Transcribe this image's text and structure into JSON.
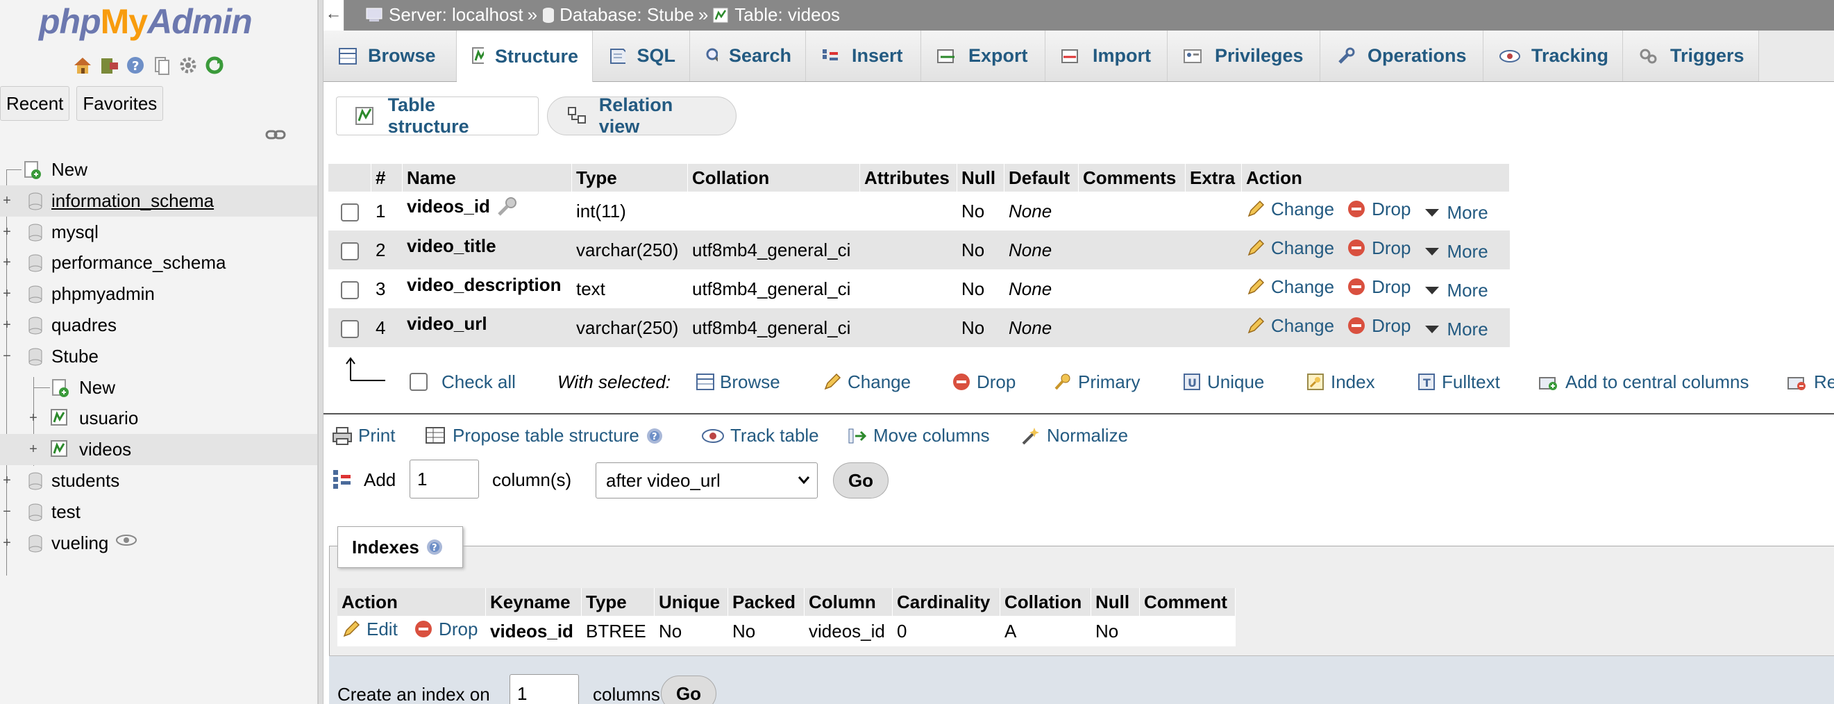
{
  "logo": {
    "php": "php",
    "my": "My",
    "admin": "Admin"
  },
  "nav": {
    "tabs": [
      "Recent",
      "Favorites"
    ],
    "tree": [
      {
        "label": "New",
        "type": "new",
        "level": 0
      },
      {
        "label": "information_schema",
        "type": "db",
        "level": 0,
        "hover": true
      },
      {
        "label": "mysql",
        "type": "db",
        "level": 0
      },
      {
        "label": "performance_schema",
        "type": "db",
        "level": 0
      },
      {
        "label": "phpmyadmin",
        "type": "db",
        "level": 0
      },
      {
        "label": "quadres",
        "type": "db",
        "level": 0
      },
      {
        "label": "Stube",
        "type": "db",
        "level": 0,
        "expanded": true
      },
      {
        "label": "New",
        "type": "new",
        "level": 1
      },
      {
        "label": "usuario",
        "type": "table",
        "level": 1
      },
      {
        "label": "videos",
        "type": "table",
        "level": 1,
        "selected": true
      },
      {
        "label": "students",
        "type": "db",
        "level": 0
      },
      {
        "label": "test",
        "type": "db",
        "level": 0,
        "expanded": true
      },
      {
        "label": "vueling",
        "type": "db",
        "level": 0,
        "eye": true
      }
    ]
  },
  "breadcrumb": {
    "server": "Server: localhost",
    "database": "Database: Stube",
    "table": "Table: videos",
    "sep": "»"
  },
  "tabs": [
    {
      "label": "Browse",
      "icon": "browse-icon"
    },
    {
      "label": "Structure",
      "icon": "structure-icon",
      "active": true
    },
    {
      "label": "SQL",
      "icon": "sql-icon"
    },
    {
      "label": "Search",
      "icon": "search-icon"
    },
    {
      "label": "Insert",
      "icon": "insert-icon"
    },
    {
      "label": "Export",
      "icon": "export-icon"
    },
    {
      "label": "Import",
      "icon": "import-icon"
    },
    {
      "label": "Privileges",
      "icon": "privileges-icon"
    },
    {
      "label": "Operations",
      "icon": "operations-icon"
    },
    {
      "label": "Tracking",
      "icon": "tracking-icon"
    },
    {
      "label": "Triggers",
      "icon": "triggers-icon"
    }
  ],
  "subtabs": {
    "table_structure": "Table structure",
    "relation_view": "Relation view"
  },
  "structure": {
    "headers": [
      "#",
      "Name",
      "Type",
      "Collation",
      "Attributes",
      "Null",
      "Default",
      "Comments",
      "Extra",
      "Action"
    ],
    "rows": [
      {
        "num": "1",
        "name": "videos_id",
        "key": true,
        "type": "int(11)",
        "collation": "",
        "attributes": "",
        "null": "No",
        "default": "None",
        "comments": "",
        "extra": ""
      },
      {
        "num": "2",
        "name": "video_title",
        "type": "varchar(250)",
        "collation": "utf8mb4_general_ci",
        "attributes": "",
        "null": "No",
        "default": "None",
        "comments": "",
        "extra": ""
      },
      {
        "num": "3",
        "name": "video_description",
        "type": "text",
        "collation": "utf8mb4_general_ci",
        "attributes": "",
        "null": "No",
        "default": "None",
        "comments": "",
        "extra": ""
      },
      {
        "num": "4",
        "name": "video_url",
        "type": "varchar(250)",
        "collation": "utf8mb4_general_ci",
        "attributes": "",
        "null": "No",
        "default": "None",
        "comments": "",
        "extra": ""
      }
    ],
    "actions": {
      "change": "Change",
      "drop": "Drop",
      "more": "More"
    }
  },
  "with_selected": {
    "check_all": "Check all",
    "label": "With selected:",
    "browse": "Browse",
    "change": "Change",
    "drop": "Drop",
    "primary": "Primary",
    "unique": "Unique",
    "index": "Index",
    "fulltext": "Fulltext",
    "central": "Add to central columns",
    "remove": "Re"
  },
  "tools": {
    "print": "Print",
    "propose": "Propose table structure",
    "track": "Track table",
    "move": "Move columns",
    "normalize": "Normalize"
  },
  "add_columns": {
    "add": "Add",
    "count": "1",
    "columns_label": "column(s)",
    "position": "after video_url",
    "go": "Go"
  },
  "indexes": {
    "legend": "Indexes",
    "headers": [
      "Action",
      "Keyname",
      "Type",
      "Unique",
      "Packed",
      "Column",
      "Cardinality",
      "Collation",
      "Null",
      "Comment"
    ],
    "edit": "Edit",
    "drop": "Drop",
    "row": {
      "keyname": "videos_id",
      "type": "BTREE",
      "unique": "No",
      "packed": "No",
      "column": "videos_id",
      "cardinality": "0",
      "collation": "A",
      "null": "No",
      "comment": ""
    }
  },
  "create_index": {
    "label": "Create an index on",
    "count": "1",
    "columns": "columns",
    "go": "Go"
  }
}
